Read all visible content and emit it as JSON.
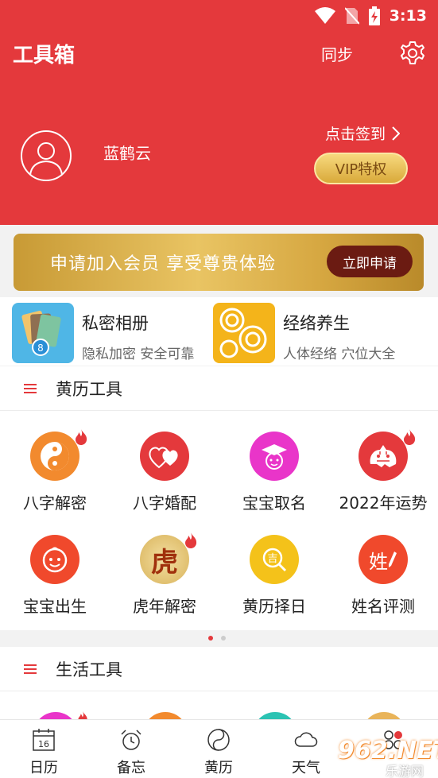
{
  "status_bar": {
    "time": "3:13"
  },
  "header": {
    "title": "工具箱",
    "sync_label": "同步",
    "username": "蓝鹤云",
    "checkin_label": "点击签到",
    "vip_label": "VIP特权"
  },
  "banner": {
    "text": "申请加入会员  享受尊贵体验",
    "button_label": "立即申请"
  },
  "features": [
    {
      "title": "私密相册",
      "subtitle": "隐私加密 安全可靠"
    },
    {
      "title": "经络养生",
      "subtitle": "人体经络 穴位大全"
    }
  ],
  "almanac_tools": {
    "title": "黄历工具",
    "items": [
      {
        "label": "八字解密",
        "icon": "yin-yang-icon",
        "hot": true
      },
      {
        "label": "八字婚配",
        "icon": "hearts-icon",
        "hot": false
      },
      {
        "label": "宝宝取名",
        "icon": "graduation-baby-icon",
        "hot": false
      },
      {
        "label": "2022年运势",
        "icon": "tiger-papercut-icon",
        "hot": true
      },
      {
        "label": "宝宝出生",
        "icon": "baby-face-icon",
        "hot": false
      },
      {
        "label": "虎年解密",
        "icon": "tiger-character-icon",
        "hot": true
      },
      {
        "label": "黄历择日",
        "icon": "search-lucky-icon",
        "hot": false
      },
      {
        "label": "姓名评测",
        "icon": "name-pen-icon",
        "hot": false
      }
    ],
    "tiger_char": "虎",
    "lucky_char": "吉",
    "name_char": "姓"
  },
  "life_tools": {
    "title": "生活工具"
  },
  "tabbar": {
    "items": [
      {
        "label": "日历",
        "icon": "calendar-icon",
        "day": "16"
      },
      {
        "label": "备忘",
        "icon": "alarm-clock-icon"
      },
      {
        "label": "黄历",
        "icon": "yin-yang-outline-icon"
      },
      {
        "label": "天气",
        "icon": "cloud-icon"
      },
      {
        "label": "",
        "icon": "more-icon"
      }
    ]
  },
  "watermark": {
    "number": "962.NET",
    "sub": "乐游网"
  },
  "colors": {
    "primary": "#e4393c",
    "gold": "#d9a93a",
    "apply_button": "#6b1b12"
  }
}
